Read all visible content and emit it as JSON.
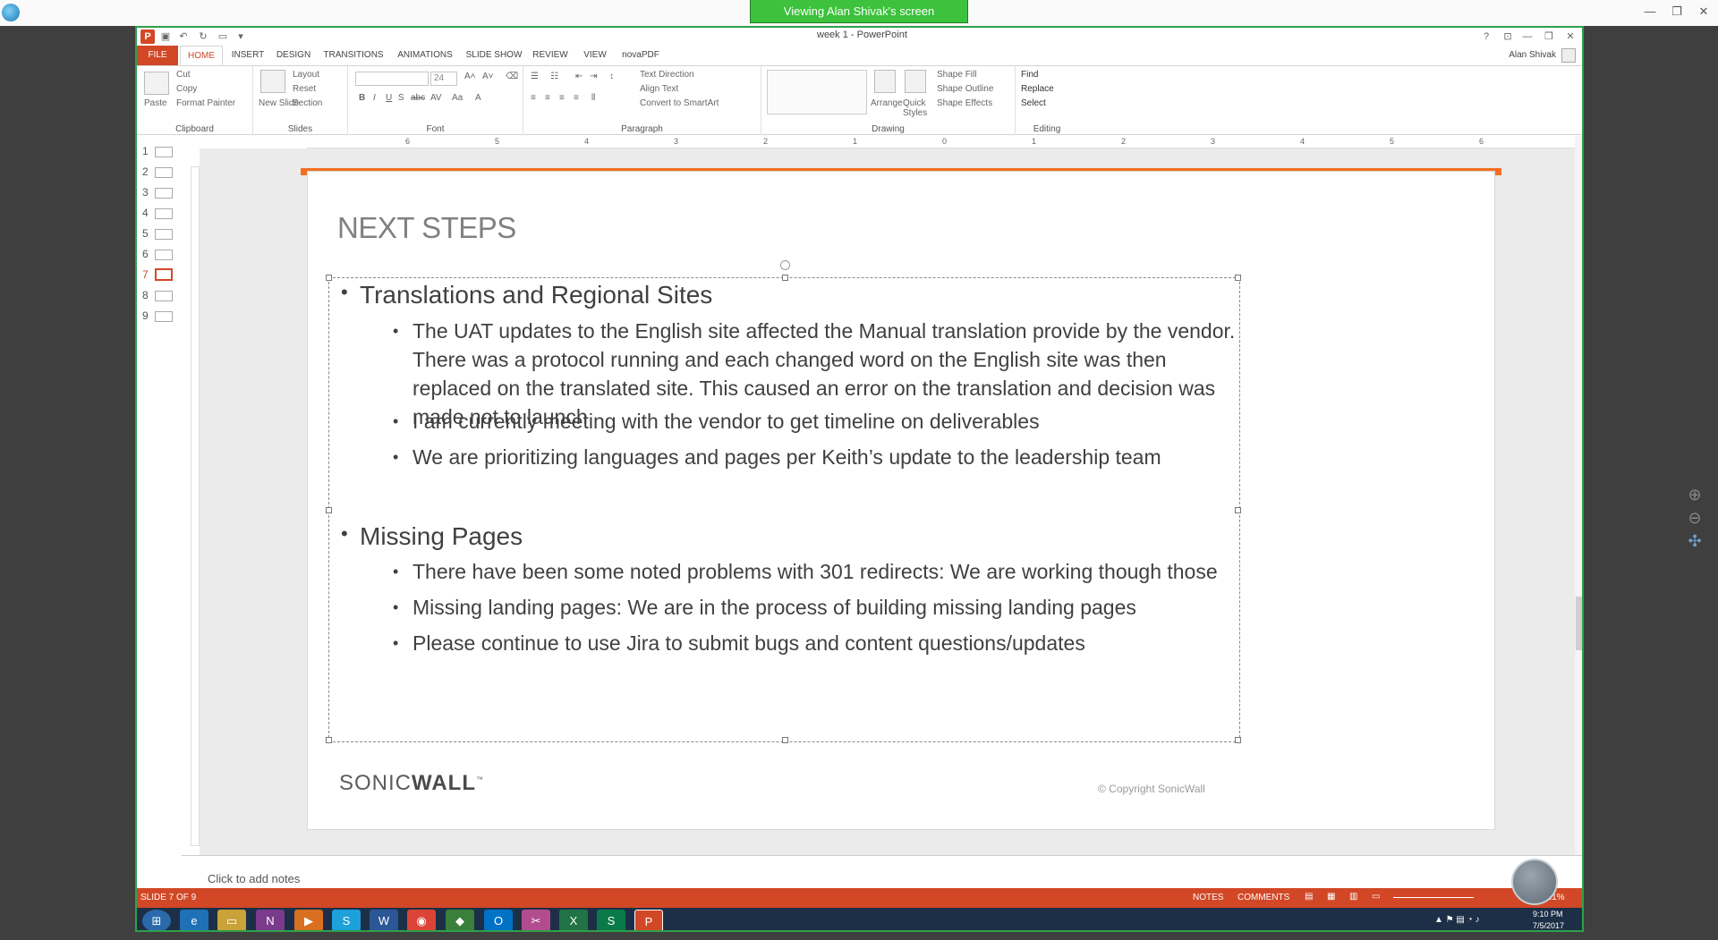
{
  "viewer": {
    "banner": "Viewing Alan Shivak's screen"
  },
  "window": {
    "title": "week 1 - PowerPoint",
    "help": "?",
    "user": "Alan Shivak"
  },
  "tabs": [
    "FILE",
    "HOME",
    "INSERT",
    "DESIGN",
    "TRANSITIONS",
    "ANIMATIONS",
    "SLIDE SHOW",
    "REVIEW",
    "VIEW",
    "novaPDF"
  ],
  "ribbon": {
    "clipboard": {
      "label": "Clipboard",
      "paste": "Paste",
      "cut": "Cut",
      "copy": "Copy",
      "format_painter": "Format Painter"
    },
    "slides": {
      "label": "Slides",
      "new_slide": "New Slide",
      "layout": "Layout",
      "reset": "Reset",
      "section": "Section"
    },
    "font": {
      "label": "Font",
      "size": "24",
      "bold": "B",
      "italic": "I",
      "underline": "U",
      "strike": "S",
      "shadow": "abc",
      "spacing": "AV",
      "case": "Aa",
      "color": "A"
    },
    "paragraph": {
      "label": "Paragraph",
      "text_direction": "Text Direction",
      "align_text": "Align Text",
      "convert": "Convert to SmartArt"
    },
    "drawing": {
      "label": "Drawing",
      "arrange": "Arrange",
      "quick_styles": "Quick Styles",
      "shape_fill": "Shape Fill",
      "shape_outline": "Shape Outline",
      "shape_effects": "Shape Effects"
    },
    "editing": {
      "label": "Editing",
      "find": "Find",
      "replace": "Replace",
      "select": "Select"
    }
  },
  "slide_thumbnails": [
    "1",
    "2",
    "3",
    "4",
    "5",
    "6",
    "7",
    "8",
    "9"
  ],
  "ruler_marks": [
    "6",
    "5",
    "4",
    "3",
    "2",
    "1",
    "0",
    "1",
    "2",
    "3",
    "4",
    "5",
    "6"
  ],
  "slide": {
    "title": "NEXT STEPS",
    "sections": [
      {
        "heading": "Translations and Regional Sites",
        "bullets": [
          "The UAT updates to the English site affected the Manual translation provide by the vendor. There was a protocol running and each changed word on the English site was then replaced on the translated site. This caused an error on the translation and decision was made not to launch",
          "I am currently meeting with the vendor to get timeline on deliverables",
          "We are prioritizing languages and pages per Keith’s update to the leadership team"
        ]
      },
      {
        "heading": "Missing Pages",
        "bullets": [
          "There have been some noted problems with 301 redirects: We are working though those",
          "Missing landing pages: We are in the process of building missing landing pages",
          "Please continue to use Jira to submit bugs and content questions/updates"
        ]
      }
    ],
    "logo_sonic": "SONIC",
    "logo_wall": "WALL",
    "logo_tm": "™",
    "copyright": "© Copyright SonicWall"
  },
  "notes_placeholder": "Click to add notes",
  "status": {
    "slide_info": "SLIDE 7 OF 9",
    "notes": "NOTES",
    "comments": "COMMENTS",
    "zoom": "121%"
  },
  "taskbar": {
    "time": "9:10 PM",
    "date": "7/5/2017"
  },
  "colors": {
    "accent": "#d24726",
    "orange_bar": "#f36f21",
    "viewer_green": "#3cc23c"
  }
}
